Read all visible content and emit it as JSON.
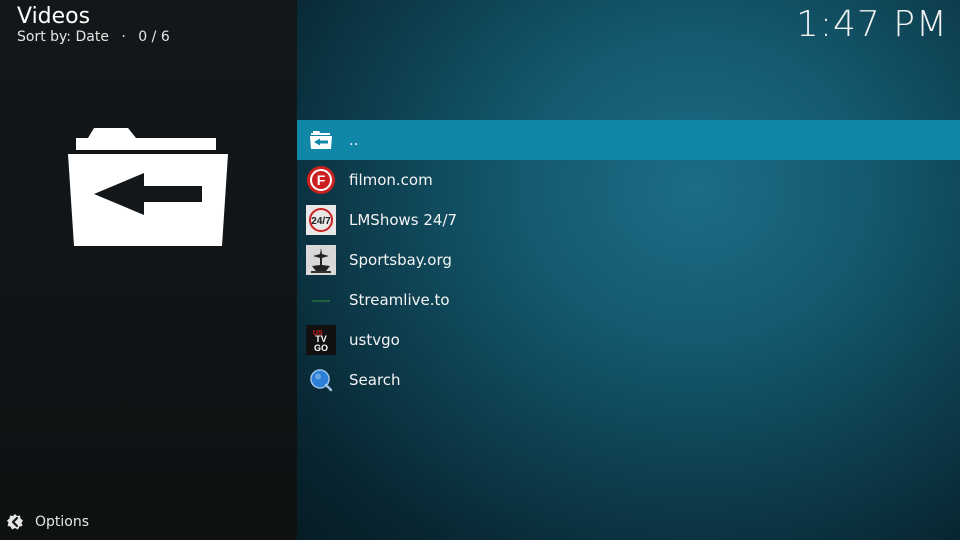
{
  "header": {
    "title": "Videos",
    "sort_label": "Sort by: Date",
    "separator": "·",
    "count": "0 / 6"
  },
  "clock": "1:47 PM",
  "big_icon": "folder-back-icon",
  "list": {
    "items": [
      {
        "label": "..",
        "icon": "folder-back-icon",
        "selected": true
      },
      {
        "label": "filmon.com",
        "icon": "filmon-logo"
      },
      {
        "label": "LMShows 24/7",
        "icon": "lmshows-logo"
      },
      {
        "label": "Sportsbay.org",
        "icon": "sportsbay-logo"
      },
      {
        "label": "Streamlive.to",
        "icon": "streamlive-logo"
      },
      {
        "label": "ustvgo",
        "icon": "ustvgo-logo"
      },
      {
        "label": "Search",
        "icon": "search-icon"
      }
    ]
  },
  "thumb_text": {
    "filmon": "F",
    "lmshows": "24/7",
    "streamlive": "streamlive",
    "ustvgo_top": "US",
    "ustvgo_mid": "TV",
    "ustvgo_bot": "GO"
  },
  "footer": {
    "options_label": "Options",
    "options_icon": "options-gear-icon"
  },
  "colors": {
    "selected_row": "#1187a8",
    "left_panel": "#141719",
    "right_panel": "#145a70"
  }
}
